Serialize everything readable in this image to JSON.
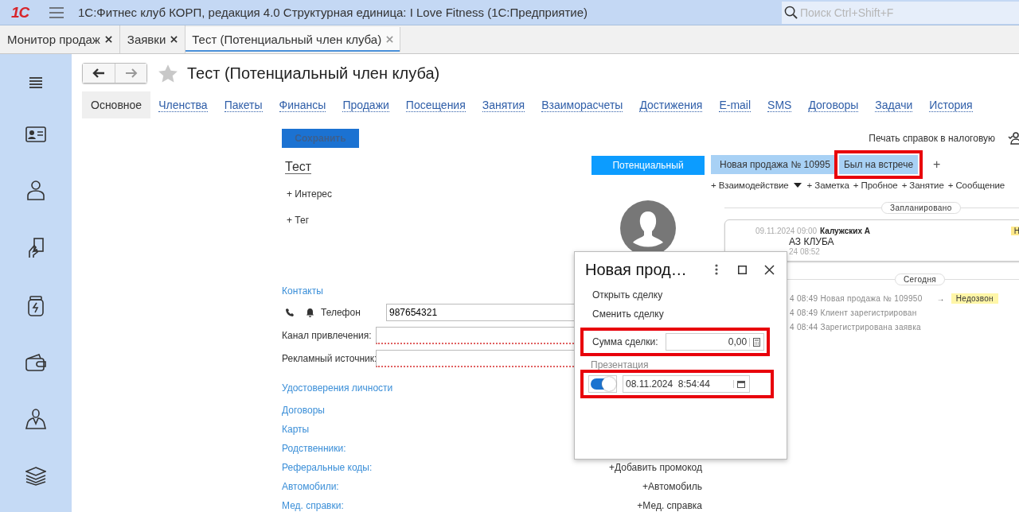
{
  "app_bar": {
    "logo": "1С",
    "title": "1С:Фитнес клуб КОРП, редакция 4.0 Структурная единица: I Love Fitness  (1С:Предприятие)",
    "search": {
      "placeholder": "Поиск Ctrl+Shift+F"
    }
  },
  "open_tabs": [
    {
      "label": "Монитор продаж",
      "selected": false
    },
    {
      "label": "Заявки",
      "selected": false
    },
    {
      "label": "Тест (Потенциальный член клуба)",
      "selected": true
    }
  ],
  "form": {
    "title": "Тест (Потенциальный член клуба)",
    "favorite": false,
    "tabs": [
      {
        "label": "Основное",
        "selected": true
      },
      {
        "label": "Членства",
        "selected": false
      },
      {
        "label": "Пакеты",
        "selected": false
      },
      {
        "label": "Финансы",
        "selected": false
      },
      {
        "label": "Продажи",
        "selected": false
      },
      {
        "label": "Посещения",
        "selected": false
      },
      {
        "label": "Занятия",
        "selected": false
      },
      {
        "label": "Взаиморасчеты",
        "selected": false
      },
      {
        "label": "Достижения",
        "selected": false
      },
      {
        "label": "E-mail",
        "selected": false
      },
      {
        "label": "SMS",
        "selected": false
      },
      {
        "label": "Договоры",
        "selected": false
      },
      {
        "label": "Задачи",
        "selected": false
      },
      {
        "label": "История",
        "selected": false
      }
    ],
    "save_button": "Сохранить",
    "name": "Тест",
    "status_button": "Потенциальный",
    "add_links": [
      "+ Интерес",
      "+ Тег"
    ],
    "contacts_heading": "Контакты",
    "phone": {
      "label": "Телефон",
      "value": "987654321"
    },
    "fields": [
      {
        "label": "Канал привлечения:",
        "required": true
      },
      {
        "label": "Рекламный источник:",
        "required": true
      }
    ],
    "sections": [
      {
        "label": "Удостоверения личности"
      },
      {
        "label": "Договоры"
      },
      {
        "label": "Карты"
      },
      {
        "label": "Родственники:"
      },
      {
        "label": "Реферальные коды:",
        "action": "+Добавить промокод"
      },
      {
        "label": "Автомобили:",
        "action": "+Автомобиль"
      },
      {
        "label": "Мед. справки:",
        "action": "+Мед. справка"
      }
    ]
  },
  "right_panel": {
    "print_link": "Печать справок в налоговую",
    "stages": [
      {
        "label": "Новая продажа № 10995",
        "highlighted": false
      },
      {
        "label": "Был на встрече",
        "highlighted": true
      }
    ],
    "add_stage": "+",
    "actions": [
      {
        "label": "+ Взаимодействие",
        "dropdown": true
      },
      {
        "label": "+ Заметка",
        "dropdown": false
      },
      {
        "label": "+ Пробное",
        "dropdown": false
      },
      {
        "label": "+ Занятие",
        "dropdown": false
      },
      {
        "label": "+ Сообщение",
        "dropdown": false
      }
    ],
    "scheduled": {
      "heading": "Запланировано",
      "time": "09.11.2024 09:00",
      "author": "Калужских А",
      "text": "АЗ КЛУБА",
      "created": "24 08:52",
      "badge": "Н"
    },
    "today": {
      "heading": "Сегодня",
      "items": [
        {
          "text": "4 08:49 Новая продажа № 109950",
          "arrow": "→",
          "status": "Недозвон"
        },
        {
          "text": "4 08:49 Клиент зарегистрирован"
        },
        {
          "text": "4 08:44 Зарегистрирована заявка"
        }
      ]
    }
  },
  "popup": {
    "title": "Новая прод…",
    "links": [
      "Открыть сделку",
      "Сменить сделку"
    ],
    "amount": {
      "label": "Сумма сделки:",
      "value": "0,00",
      "highlighted": true
    },
    "presentation": {
      "label": "Презентация",
      "on": true,
      "value": "08.11.2024  8:54:44",
      "highlighted": true
    }
  }
}
